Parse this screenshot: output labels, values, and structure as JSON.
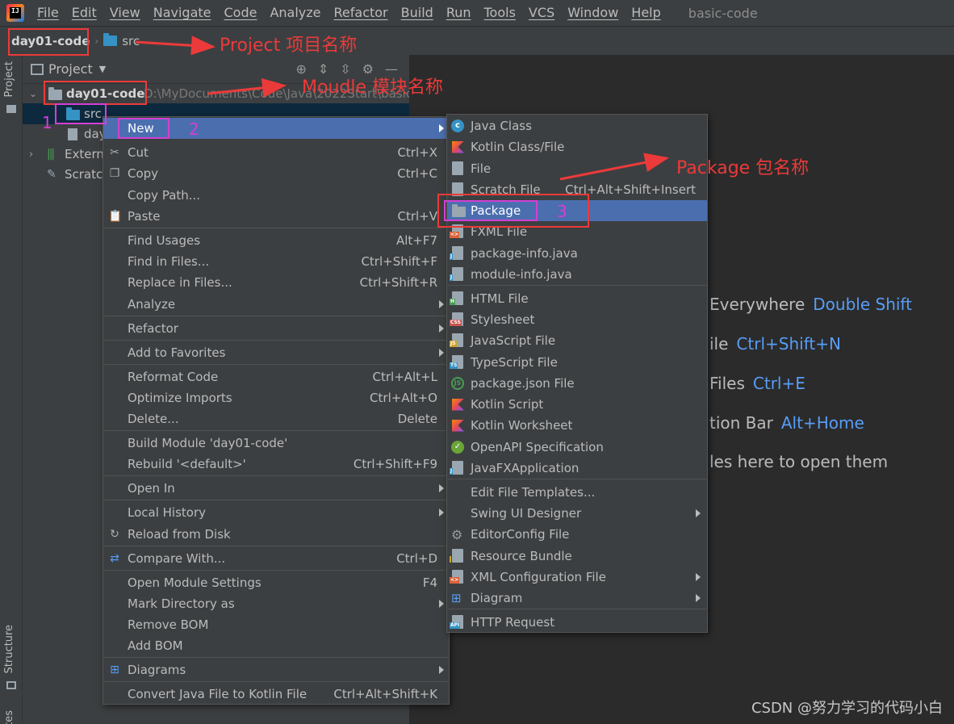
{
  "app": {
    "logo_text": "IJ",
    "window_title": "basic-code"
  },
  "menubar": [
    "File",
    "Edit",
    "View",
    "Navigate",
    "Code",
    "Analyze",
    "Refactor",
    "Build",
    "Run",
    "Tools",
    "VCS",
    "Window",
    "Help"
  ],
  "breadcrumb": {
    "project": "day01-code",
    "folder": "src"
  },
  "left_strip": {
    "project_tab": "Project",
    "structure_tab": "Structure",
    "bottom_tab": "tes"
  },
  "project_panel": {
    "title": "Project",
    "module": "day01-code",
    "module_path": "D:\\MyDocuments\\Code\\Java\\2022Start\\basic",
    "src": "src",
    "file_partial": "day",
    "external": "Extern",
    "scratches": "Scratc"
  },
  "context_menu": {
    "new": "New",
    "cut": "Cut",
    "cut_sc": "Ctrl+X",
    "copy": "Copy",
    "copy_sc": "Ctrl+C",
    "copy_path": "Copy Path...",
    "paste": "Paste",
    "paste_sc": "Ctrl+V",
    "find_usages": "Find Usages",
    "find_usages_sc": "Alt+F7",
    "find_in_files": "Find in Files...",
    "find_in_files_sc": "Ctrl+Shift+F",
    "replace_in_files": "Replace in Files...",
    "replace_in_files_sc": "Ctrl+Shift+R",
    "analyze": "Analyze",
    "refactor": "Refactor",
    "add_favorites": "Add to Favorites",
    "reformat": "Reformat Code",
    "reformat_sc": "Ctrl+Alt+L",
    "optimize": "Optimize Imports",
    "optimize_sc": "Ctrl+Alt+O",
    "delete": "Delete...",
    "delete_sc": "Delete",
    "build_module": "Build Module 'day01-code'",
    "rebuild": "Rebuild '<default>'",
    "rebuild_sc": "Ctrl+Shift+F9",
    "open_in": "Open In",
    "local_history": "Local History",
    "reload": "Reload from Disk",
    "compare": "Compare With...",
    "compare_sc": "Ctrl+D",
    "module_settings": "Open Module Settings",
    "module_settings_sc": "F4",
    "mark_dir": "Mark Directory as",
    "remove_bom": "Remove BOM",
    "add_bom": "Add BOM",
    "diagrams": "Diagrams",
    "convert": "Convert Java File to Kotlin File",
    "convert_sc": "Ctrl+Alt+Shift+K"
  },
  "submenu": {
    "java_class": "Java Class",
    "kotlin_class": "Kotlin Class/File",
    "file": "File",
    "scratch": "Scratch File",
    "scratch_sc": "Ctrl+Alt+Shift+Insert",
    "package": "Package",
    "fxml": "FXML File",
    "package_info": "package-info.java",
    "module_info": "module-info.java",
    "html": "HTML File",
    "stylesheet": "Stylesheet",
    "js": "JavaScript File",
    "ts": "TypeScript File",
    "package_json": "package.json File",
    "kotlin_script": "Kotlin Script",
    "kotlin_worksheet": "Kotlin Worksheet",
    "openapi": "OpenAPI Specification",
    "javafx": "JavaFXApplication",
    "edit_templates": "Edit File Templates...",
    "swing": "Swing UI Designer",
    "editorconfig": "EditorConfig File",
    "resource_bundle": "Resource Bundle",
    "xml_config": "XML Configuration File",
    "diagram": "Diagram",
    "http": "HTTP Request",
    "tags": {
      "fxml": "<>",
      "j": "J",
      "h": "H",
      "css": "CSS",
      "js": "JS",
      "ts": "TS",
      "xml": "<>",
      "api": "API"
    }
  },
  "editor_hints": [
    {
      "text": "Everywhere",
      "key": "Double Shift"
    },
    {
      "text": "ile",
      "key": "Ctrl+Shift+N"
    },
    {
      "text": "Files",
      "key": "Ctrl+E"
    },
    {
      "text": "tion Bar",
      "key": "Alt+Home"
    },
    {
      "text": "les here to open them",
      "key": ""
    }
  ],
  "annotations": {
    "project_label": "Project 项目名称",
    "module_label": "Moudle 模块名称",
    "package_label": "Package 包名称",
    "step1": "1",
    "step2": "2",
    "step3": "3"
  },
  "watermark": "CSDN @努力学习的代码小白",
  "colors": {
    "selection": "#4b6eaf",
    "annotation_red": "#ec3a3a",
    "annotation_magenta": "#d33fd3",
    "link_blue": "#589df6"
  }
}
